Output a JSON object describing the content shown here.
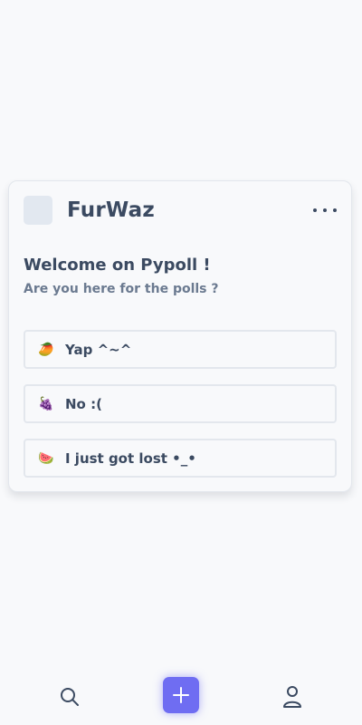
{
  "post": {
    "username": "FurWaz",
    "more_icon": "more-horizontal-icon",
    "title": "Welcome on Pypoll !",
    "subtitle": "Are you here for the polls ?",
    "options": [
      {
        "emoji": "🥭",
        "label": "Yap ^~^"
      },
      {
        "emoji": "🍇",
        "label": "No :("
      },
      {
        "emoji": "🍉",
        "label": "I just got lost •_•"
      }
    ]
  },
  "nav": {
    "search_icon": "search-icon",
    "add_icon": "plus-icon",
    "profile_icon": "user-icon",
    "accent_color": "#6f6df2"
  }
}
